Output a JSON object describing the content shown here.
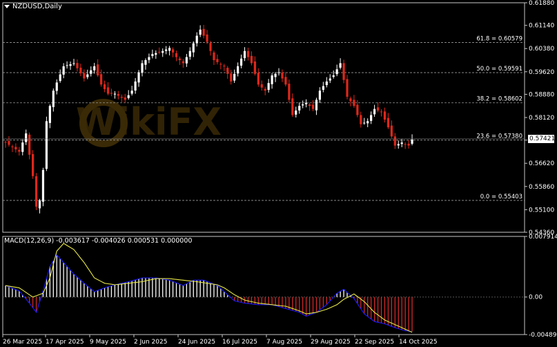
{
  "header": {
    "title": "NZDUSD,Daily"
  },
  "macd": {
    "label": "MACD(12,26,9) -0.003617 -0.004026 0.000531 0.000000"
  },
  "current_price": "0.57421",
  "watermark": "WikiFX",
  "colors": {
    "background": "#000000",
    "bull_candle": "#ffffff",
    "bear_candle": "#e0271a",
    "fib_line": "#9a9a9a",
    "macd_main": "#1a1aff",
    "macd_signal": "#e8e84a",
    "hist_pos": "#ffffff",
    "hist_neg": "#d42a2a"
  },
  "chart_data": [
    {
      "type": "candlestick",
      "title": "NZDUSD,Daily",
      "y_ticks": [
        "0.61880",
        "0.61140",
        "0.60380",
        "0.59620",
        "0.58880",
        "0.58120",
        "0.57380",
        "0.56620",
        "0.55860",
        "0.55100",
        "0.54360"
      ],
      "ylim": [
        0.5436,
        0.6188
      ],
      "x_ticks": [
        "26 Mar 2025",
        "17 Apr 2025",
        "9 May 2025",
        "2 Jun 2025",
        "24 Jun 2025",
        "16 Jul 2025",
        "7 Aug 2025",
        "29 Aug 2025",
        "22 Sep 2025",
        "14 Oct 2025"
      ],
      "fib_levels": [
        {
          "label": "61.8 = 0.60579",
          "value": 0.60579
        },
        {
          "label": "50.0 = 0.59591",
          "value": 0.59591
        },
        {
          "label": "38.2 = 0.58602",
          "value": 0.58602
        },
        {
          "label": "23.6 = 0.57380",
          "value": 0.5738
        },
        {
          "label": "0.0 = 0.55403",
          "value": 0.55403
        }
      ],
      "close_path": [
        [
          0,
          0.573
        ],
        [
          4,
          0.57
        ],
        [
          6,
          0.576
        ],
        [
          8,
          0.562
        ],
        [
          9,
          0.552
        ],
        [
          10,
          0.554
        ],
        [
          11,
          0.564
        ],
        [
          12,
          0.58
        ],
        [
          14,
          0.59
        ],
        [
          17,
          0.598
        ],
        [
          20,
          0.599
        ],
        [
          23,
          0.594
        ],
        [
          26,
          0.598
        ],
        [
          28,
          0.592
        ],
        [
          30,
          0.589
        ],
        [
          32,
          0.589
        ],
        [
          35,
          0.587
        ],
        [
          37,
          0.59
        ],
        [
          40,
          0.599
        ],
        [
          43,
          0.602
        ],
        [
          46,
          0.603
        ],
        [
          48,
          0.604
        ],
        [
          50,
          0.601
        ],
        [
          52,
          0.599
        ],
        [
          54,
          0.603
        ],
        [
          56,
          0.608
        ],
        [
          57,
          0.61
        ],
        [
          59,
          0.606
        ],
        [
          61,
          0.6
        ],
        [
          64,
          0.598
        ],
        [
          66,
          0.593
        ],
        [
          68,
          0.598
        ],
        [
          70,
          0.603
        ],
        [
          72,
          0.599
        ],
        [
          74,
          0.592
        ],
        [
          76,
          0.59
        ],
        [
          78,
          0.595
        ],
        [
          80,
          0.596
        ],
        [
          82,
          0.592
        ],
        [
          84,
          0.582
        ],
        [
          86,
          0.585
        ],
        [
          88,
          0.586
        ],
        [
          90,
          0.584
        ],
        [
          92,
          0.59
        ],
        [
          94,
          0.593
        ],
        [
          96,
          0.595
        ],
        [
          98,
          0.599
        ],
        [
          100,
          0.588
        ],
        [
          102,
          0.585
        ],
        [
          104,
          0.579
        ],
        [
          106,
          0.58
        ],
        [
          108,
          0.584
        ],
        [
          110,
          0.583
        ],
        [
          112,
          0.578
        ],
        [
          114,
          0.572
        ],
        [
          116,
          0.573
        ],
        [
          118,
          0.572
        ],
        [
          119,
          0.574
        ]
      ]
    },
    {
      "type": "bar",
      "title": "MACD(12,26,9) -0.003617 -0.004026 0.000531 0.000000",
      "y_ticks": [
        "0.007914",
        "0.00",
        "-0.004898"
      ],
      "ylim": [
        -0.004898,
        0.007914
      ],
      "series": [
        {
          "values_path": [
            [
              0,
              0.0015
            ],
            [
              4,
              0.0008
            ],
            [
              7,
              -0.0008
            ],
            [
              9,
              -0.002
            ],
            [
              11,
              0.0008
            ],
            [
              13,
              0.004
            ],
            [
              15,
              0.0055
            ],
            [
              17,
              0.0045
            ],
            [
              20,
              0.003
            ],
            [
              23,
              0.0018
            ],
            [
              26,
              0.0007
            ],
            [
              29,
              0.0012
            ],
            [
              32,
              0.0016
            ],
            [
              36,
              0.002
            ],
            [
              40,
              0.0025
            ],
            [
              44,
              0.0025
            ],
            [
              48,
              0.0022
            ],
            [
              52,
              0.0015
            ],
            [
              55,
              0.0022
            ],
            [
              58,
              0.0022
            ],
            [
              62,
              0.0015
            ],
            [
              64,
              0.0007
            ],
            [
              67,
              -0.0005
            ],
            [
              70,
              -0.0008
            ],
            [
              74,
              -0.001
            ],
            [
              78,
              -0.001
            ],
            [
              82,
              -0.0015
            ],
            [
              86,
              -0.002
            ],
            [
              88,
              -0.0025
            ],
            [
              91,
              -0.002
            ],
            [
              94,
              -0.001
            ],
            [
              97,
              0.0005
            ],
            [
              99,
              0.001
            ],
            [
              102,
              -0.0002
            ],
            [
              105,
              -0.0022
            ],
            [
              108,
              -0.0032
            ],
            [
              111,
              -0.0035
            ],
            [
              114,
              -0.004
            ],
            [
              117,
              -0.0044
            ],
            [
              119,
              -0.0045
            ]
          ]
        },
        {
          "values_path": [
            [
              0,
              0.0015
            ],
            [
              4,
              0.0012
            ],
            [
              8,
              0.0
            ],
            [
              11,
              0.0005
            ],
            [
              13,
              0.0025
            ],
            [
              15,
              0.006
            ],
            [
              17,
              0.007
            ],
            [
              20,
              0.0062
            ],
            [
              23,
              0.0045
            ],
            [
              26,
              0.0025
            ],
            [
              29,
              0.0018
            ],
            [
              32,
              0.0016
            ],
            [
              36,
              0.0018
            ],
            [
              40,
              0.002
            ],
            [
              44,
              0.0024
            ],
            [
              48,
              0.0024
            ],
            [
              52,
              0.0022
            ],
            [
              56,
              0.002
            ],
            [
              59,
              0.0018
            ],
            [
              62,
              0.0016
            ],
            [
              64,
              0.0012
            ],
            [
              67,
              0.0003
            ],
            [
              70,
              -0.0004
            ],
            [
              74,
              -0.0008
            ],
            [
              78,
              -0.001
            ],
            [
              82,
              -0.0012
            ],
            [
              86,
              -0.0018
            ],
            [
              88,
              -0.0022
            ],
            [
              91,
              -0.002
            ],
            [
              94,
              -0.0016
            ],
            [
              97,
              -0.001
            ],
            [
              99,
              -0.0003
            ],
            [
              102,
              0.0004
            ],
            [
              105,
              -0.0006
            ],
            [
              108,
              -0.002
            ],
            [
              111,
              -0.003
            ],
            [
              114,
              -0.0036
            ],
            [
              117,
              -0.0042
            ],
            [
              119,
              -0.0046
            ]
          ]
        }
      ]
    }
  ]
}
